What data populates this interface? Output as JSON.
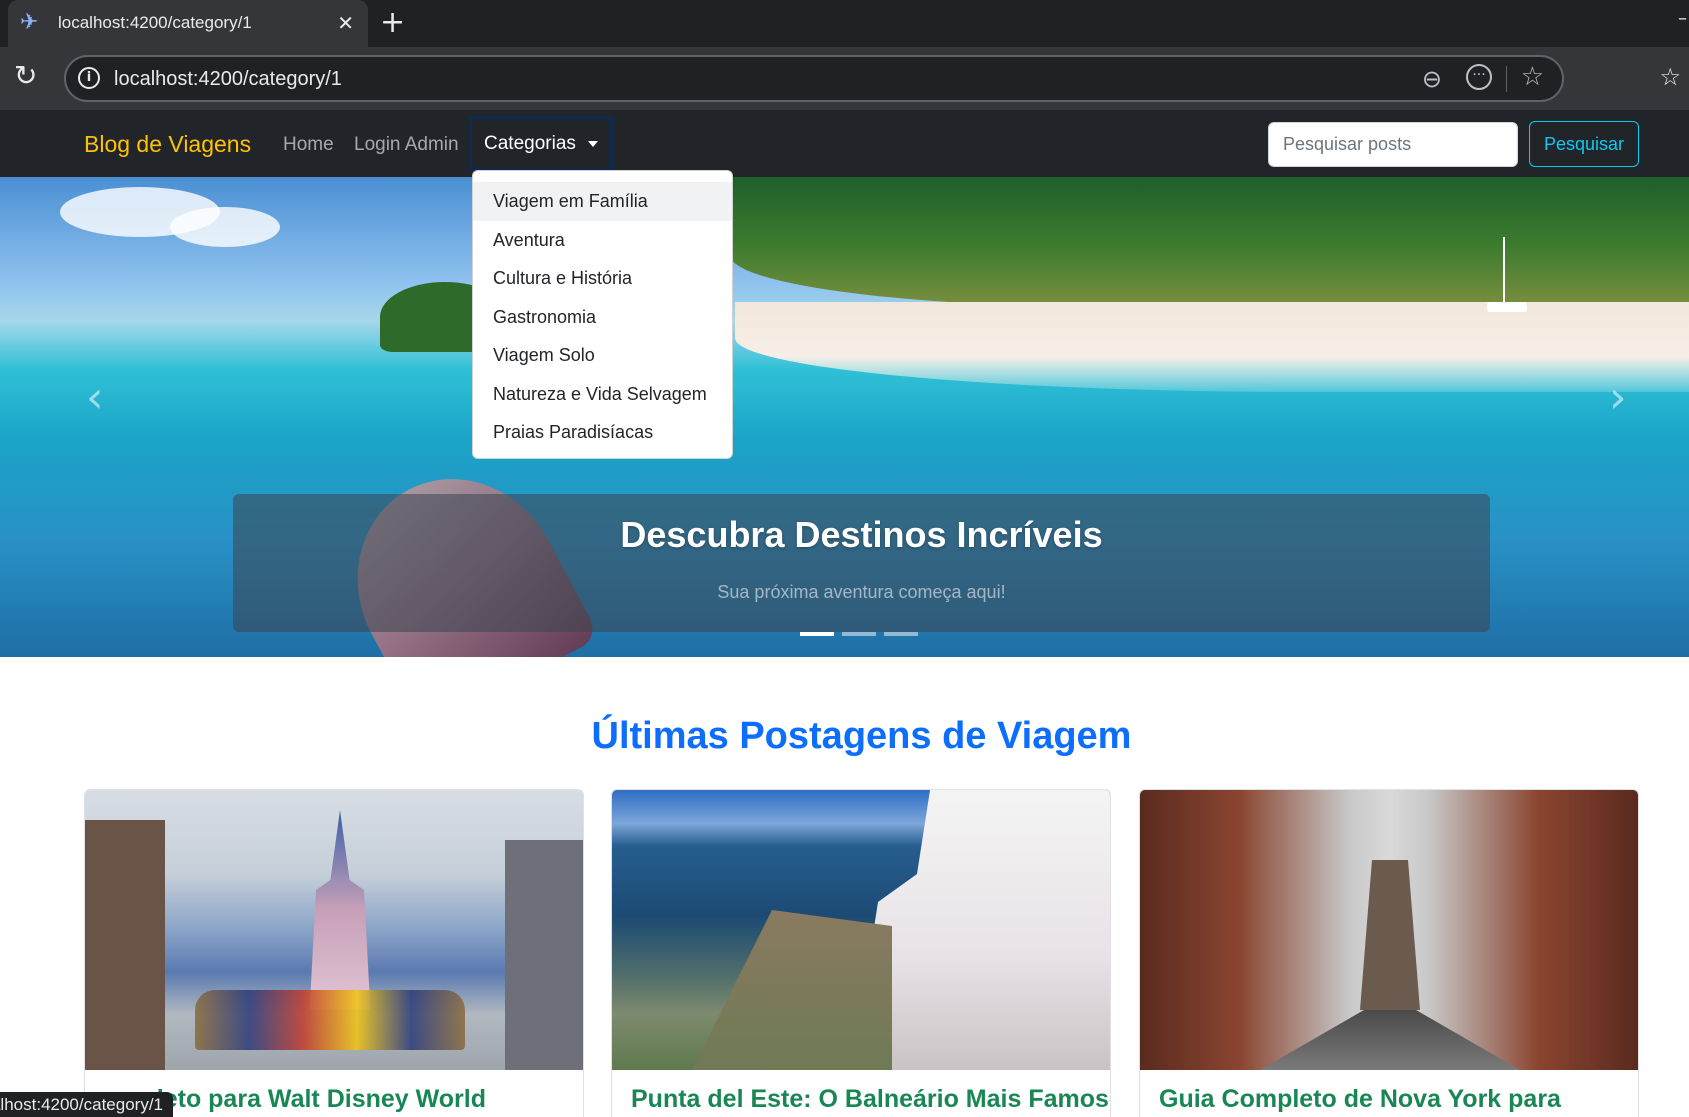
{
  "browser": {
    "tab_title": "localhost:4200/category/1",
    "url": "localhost:4200/category/1",
    "status_url": "localhost:4200/category/1"
  },
  "navbar": {
    "brand": "Blog de Viagens",
    "home": "Home",
    "login": "Login Admin",
    "categories": "Categorias",
    "search_placeholder": "Pesquisar posts",
    "search_button": "Pesquisar"
  },
  "dropdown": {
    "items": [
      "Viagem em Família",
      "Aventura",
      "Cultura e História",
      "Gastronomia",
      "Viagem Solo",
      "Natureza e Vida Selvagem",
      "Praias Paradisíacas"
    ]
  },
  "hero": {
    "title": "Descubra Destinos Incríveis",
    "subtitle": "Sua próxima aventura começa aqui!",
    "slide_count": 3,
    "active_slide": 1
  },
  "posts": {
    "section_title": "Últimas Postagens de Viagem",
    "cards": [
      {
        "title": "ompleto para Walt Disney World"
      },
      {
        "title": "Punta del Este: O Balneário Mais Famoso"
      },
      {
        "title": "Guia Completo de Nova York para"
      }
    ]
  },
  "colors": {
    "navbar_bg": "#212529",
    "brand": "#ffc107",
    "search_button": "#0dcaf0",
    "section_title": "#0d6efd",
    "card_title": "#198754"
  }
}
